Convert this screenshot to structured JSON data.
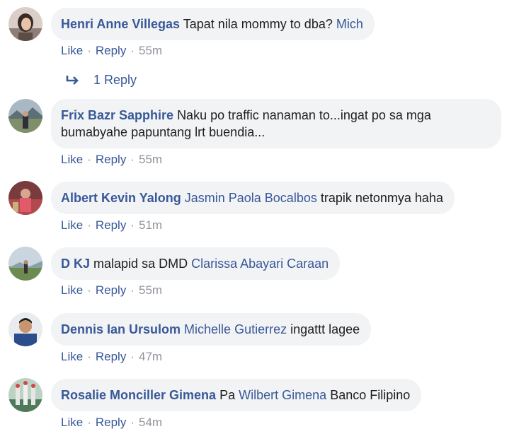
{
  "comments": [
    {
      "author": "Henri Anne Villegas",
      "text_parts": [
        "Tapat nila mommy to dba? ",
        "Mich"
      ],
      "text_before": "Tapat nila mommy to dba?",
      "mention": "Mich",
      "text_after": "",
      "like": "Like",
      "reply": "Reply",
      "time": "55m"
    },
    {
      "author": "Frix Bazr Sapphire",
      "text_line1": "Naku po traffic nanaman to...ingat po sa mga",
      "text_line2": "bumabyahe papuntang lrt buendia...",
      "like": "Like",
      "reply": "Reply",
      "time": "55m"
    },
    {
      "author": "Albert Kevin Yalong",
      "mention": "Jasmin Paola Bocalbos",
      "text_after": "trapik netonmya haha",
      "like": "Like",
      "reply": "Reply",
      "time": "51m"
    },
    {
      "author": "D KJ",
      "text_before": "malapid sa DMD",
      "mention": "Clarissa Abayari Caraan",
      "like": "Like",
      "reply": "Reply",
      "time": "55m"
    },
    {
      "author": "Dennis Ian Ursulom",
      "mention": "Michelle Gutierrez",
      "text_after": "ingattt lagee",
      "like": "Like",
      "reply": "Reply",
      "time": "47m"
    },
    {
      "author": "Rosalie Monciller Gimena",
      "text_before": "Pa",
      "mention": "Wilbert Gimena",
      "text_after": "Banco Filipino",
      "like": "Like",
      "reply": "Reply",
      "time": "54m"
    }
  ],
  "replies_link": "1 Reply",
  "separator": "·",
  "colors": {
    "link": "#385898",
    "bubble_bg": "#f2f3f5",
    "meta_gray": "#90949c",
    "text": "#1c1e21"
  },
  "icons": {
    "reply_arrow": "reply-arrow-icon"
  }
}
